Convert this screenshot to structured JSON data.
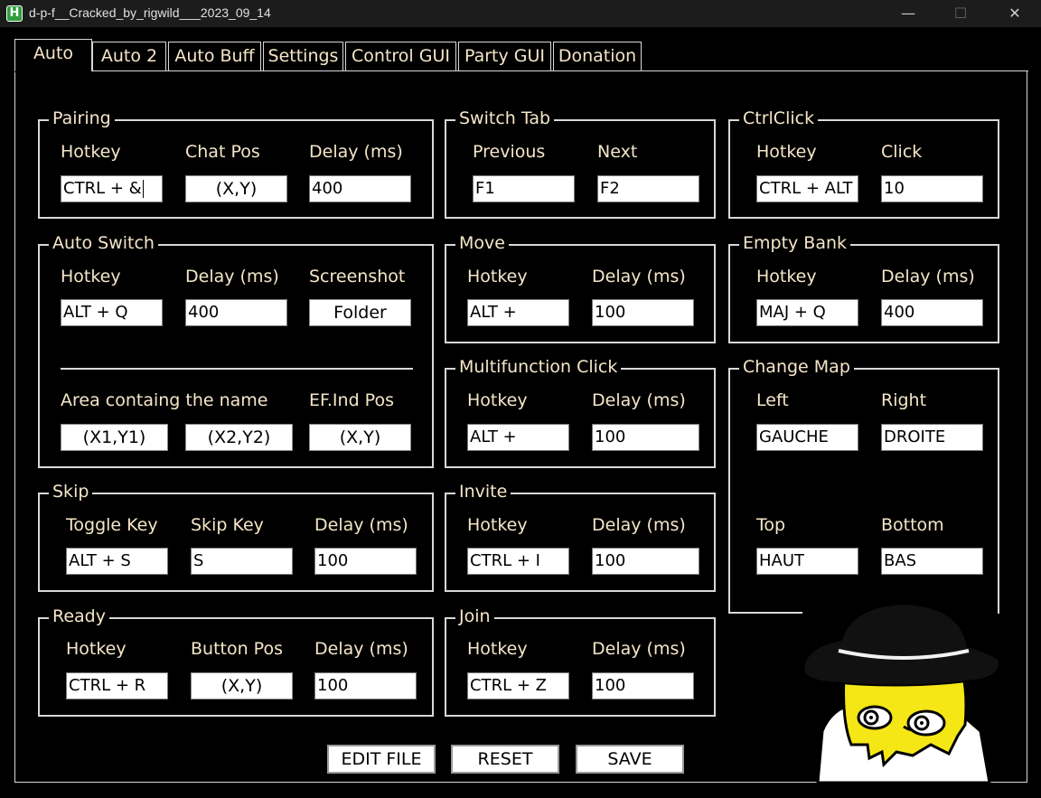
{
  "window": {
    "title": "d-p-f__Cracked_by_rigwild___2023_09_14",
    "icon_letter": "H",
    "minimize": "—",
    "maximize": "☐",
    "close": "✕"
  },
  "tabs": [
    {
      "label": "Auto",
      "active": true
    },
    {
      "label": "Auto 2"
    },
    {
      "label": "Auto Buff"
    },
    {
      "label": "Settings"
    },
    {
      "label": "Control GUI"
    },
    {
      "label": "Party GUI"
    },
    {
      "label": "Donation"
    }
  ],
  "groups": {
    "pairing": {
      "title": "Pairing",
      "labels": [
        "Hotkey",
        "Chat Pos",
        "Delay (ms)"
      ],
      "hotkey": "CTRL + &",
      "chat_pos": "(X,Y)",
      "delay": "400"
    },
    "switch_tab": {
      "title": "Switch Tab",
      "labels": [
        "Previous",
        "Next"
      ],
      "previous": "F1",
      "next": "F2"
    },
    "ctrlclick": {
      "title": "CtrlClick",
      "labels": [
        "Hotkey",
        "Click"
      ],
      "hotkey": "CTRL + ALT",
      "click": "10"
    },
    "auto_switch": {
      "title": "Auto Switch",
      "labels": [
        "Hotkey",
        "Delay (ms)",
        "Screenshot"
      ],
      "hotkey": "ALT + Q",
      "delay": "400",
      "screenshot_button": "Folder",
      "area_label": "Area containg the name",
      "ef_label": "EF.Ind Pos",
      "area_start": "(X1,Y1)",
      "area_end": "(X2,Y2)",
      "ef_pos": "(X,Y)"
    },
    "move": {
      "title": "Move",
      "labels": [
        "Hotkey",
        "Delay (ms)"
      ],
      "hotkey": "ALT +",
      "delay": "100"
    },
    "empty_bank": {
      "title": "Empty Bank",
      "labels": [
        "Hotkey",
        "Delay (ms)"
      ],
      "hotkey": "MAJ + Q",
      "delay": "400"
    },
    "multifunction_click": {
      "title": "Multifunction Click",
      "labels": [
        "Hotkey",
        "Delay (ms)"
      ],
      "hotkey": "ALT +",
      "delay": "100"
    },
    "change_map": {
      "title": "Change Map",
      "labels": [
        "Left",
        "Right",
        "Top",
        "Bottom"
      ],
      "left": "GAUCHE",
      "right": "DROITE",
      "top": "HAUT",
      "bottom": "BAS"
    },
    "skip": {
      "title": "Skip",
      "labels": [
        "Toggle Key",
        "Skip Key",
        "Delay (ms)"
      ],
      "toggle_key": "ALT + S",
      "skip_key": "S",
      "delay": "100"
    },
    "invite": {
      "title": "Invite",
      "labels": [
        "Hotkey",
        "Delay (ms)"
      ],
      "hotkey": "CTRL + I",
      "delay": "100"
    },
    "ready": {
      "title": "Ready",
      "labels": [
        "Hotkey",
        "Button Pos",
        "Delay (ms)"
      ],
      "hotkey": "CTRL + R",
      "button_pos": "(X,Y)",
      "delay": "100"
    },
    "join": {
      "title": "Join",
      "labels": [
        "Hotkey",
        "Delay (ms)"
      ],
      "hotkey": "CTRL + Z",
      "delay": "100"
    }
  },
  "footer": {
    "edit_file": "EDIT FILE",
    "reset": "RESET",
    "save": "SAVE"
  },
  "colors": {
    "background": "#000000",
    "text": "#f5e6c8",
    "border": "#d8d8d8",
    "mascot_yellow": "#f5e616"
  }
}
